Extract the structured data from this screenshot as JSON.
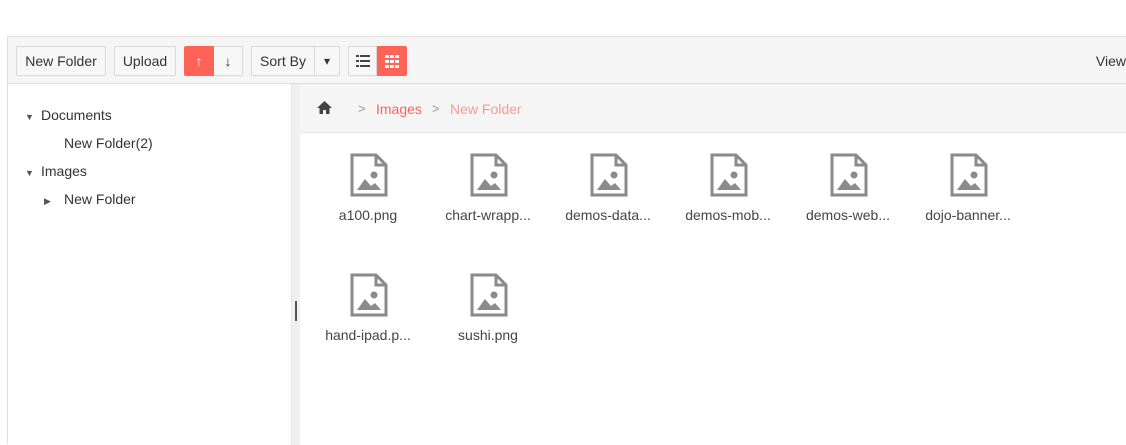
{
  "toolbar": {
    "new_folder_label": "New Folder",
    "upload_label": "Upload",
    "sort_asc_glyph": "↑",
    "sort_desc_glyph": "↓",
    "sort_by_label": "Sort By",
    "sort_dropdown_glyph": "▾",
    "view_label": "View",
    "active_view": "grid",
    "sort_direction": "ascending"
  },
  "tree": {
    "items": [
      {
        "label": "Documents",
        "expanded": true
      },
      {
        "label": "New Folder(2)"
      },
      {
        "label": "Images",
        "expanded": true
      },
      {
        "label": "New Folder",
        "expanded": false
      }
    ]
  },
  "breadcrumb": {
    "home_icon": "home-icon",
    "items": [
      "Images",
      "New Folder"
    ]
  },
  "files": [
    {
      "name": "a100.png",
      "icon": "image-file-icon"
    },
    {
      "name": "chart-wrapp...",
      "icon": "image-file-icon"
    },
    {
      "name": "demos-data...",
      "icon": "image-file-icon"
    },
    {
      "name": "demos-mob...",
      "icon": "image-file-icon"
    },
    {
      "name": "demos-web...",
      "icon": "image-file-icon"
    },
    {
      "name": "dojo-banner...",
      "icon": "image-file-icon"
    },
    {
      "name": "hand-ipad.p...",
      "icon": "image-file-icon"
    },
    {
      "name": "sushi.png",
      "icon": "image-file-icon"
    }
  ],
  "colors": {
    "accent": "#ff6358",
    "breadcrumb_current": "#f59b93",
    "icon_gray": "#8a8a8a"
  }
}
